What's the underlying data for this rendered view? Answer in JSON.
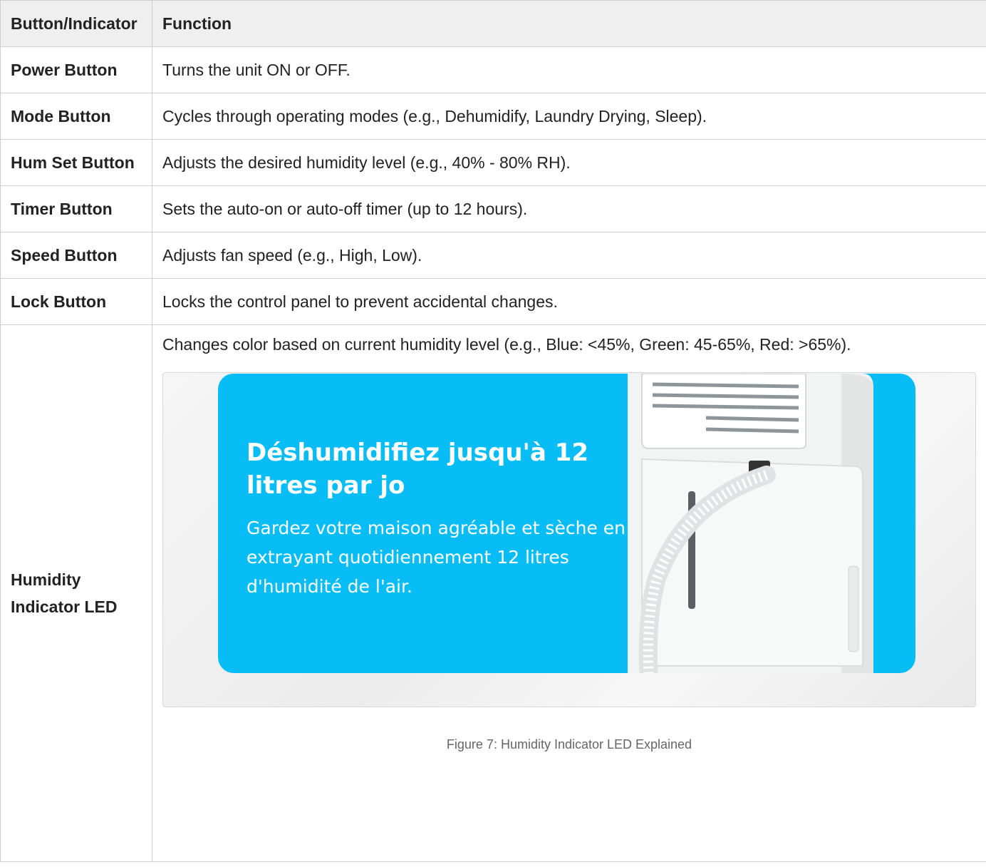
{
  "table": {
    "headers": [
      "Button/Indicator",
      "Function"
    ],
    "rows": [
      {
        "name": "Power Button",
        "function": "Turns the unit ON or OFF."
      },
      {
        "name": "Mode Button",
        "function": "Cycles through operating modes (e.g., Dehumidify, Laundry Drying, Sleep)."
      },
      {
        "name": "Hum Set Button",
        "function": "Adjusts the desired humidity level (e.g., 40% - 80% RH)."
      },
      {
        "name": "Timer Button",
        "function": "Sets the auto-on or auto-off timer (up to 12 hours)."
      },
      {
        "name": "Speed Button",
        "function": "Adjusts fan speed (e.g., High, Low)."
      },
      {
        "name": "Lock Button",
        "function": "Locks the control panel to prevent accidental changes."
      },
      {
        "name": "Humidity Indicator LED",
        "function": "Changes color based on current humidity level (e.g., Blue: <45%, Green: 45-65%, Red: >65%)."
      }
    ]
  },
  "figure": {
    "promo_title": "Déshumidifiez jusqu'à 12 litres par jo",
    "promo_body": "Gardez votre maison agréable et sèche en extrayant quotidiennement 12 litres d'humidité de l'air.",
    "caption": "Figure 7: Humidity Indicator LED Explained",
    "banner_color": "#08bdf6"
  }
}
